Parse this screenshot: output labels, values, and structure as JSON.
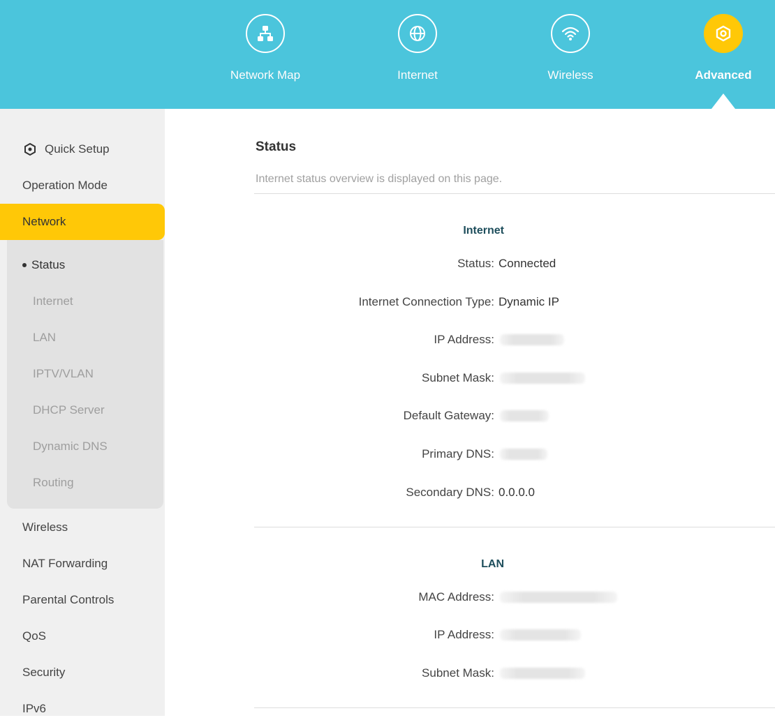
{
  "nav": {
    "items": [
      {
        "label": "Network Map",
        "icon": "network-map-icon"
      },
      {
        "label": "Internet",
        "icon": "globe-icon"
      },
      {
        "label": "Wireless",
        "icon": "wifi-icon"
      },
      {
        "label": "Advanced",
        "icon": "gear-icon"
      }
    ],
    "active": "Advanced"
  },
  "sidebar": {
    "quick_setup": "Quick Setup",
    "operation_mode": "Operation Mode",
    "network": "Network",
    "sub_items": [
      "Status",
      "Internet",
      "LAN",
      "IPTV/VLAN",
      "DHCP Server",
      "Dynamic DNS",
      "Routing"
    ],
    "current_sub": "Status",
    "items_after": [
      "Wireless",
      "NAT Forwarding",
      "Parental Controls",
      "QoS",
      "Security",
      "IPv6"
    ]
  },
  "main": {
    "title": "Status",
    "description": "Internet status overview is displayed on this page.",
    "internet": {
      "heading": "Internet",
      "status_label": "Status:",
      "status_value": "Connected",
      "conn_type_label": "Internet Connection Type:",
      "conn_type_value": "Dynamic IP",
      "ip_label": "IP Address:",
      "subnet_label": "Subnet Mask:",
      "gateway_label": "Default Gateway:",
      "primary_dns_label": "Primary DNS:",
      "secondary_dns_label": "Secondary DNS:",
      "secondary_dns_value": "0.0.0.0"
    },
    "lan": {
      "heading": "LAN",
      "mac_label": "MAC Address:",
      "ip_label": "IP Address:",
      "subnet_label": "Subnet Mask:"
    }
  },
  "colors": {
    "topbar": "#4bc5dc",
    "accent": "#ffc807",
    "sidebar_bg": "#f0f0f0",
    "subgroup_bg": "#e2e2e2",
    "section_heading": "#1e4e5c"
  }
}
